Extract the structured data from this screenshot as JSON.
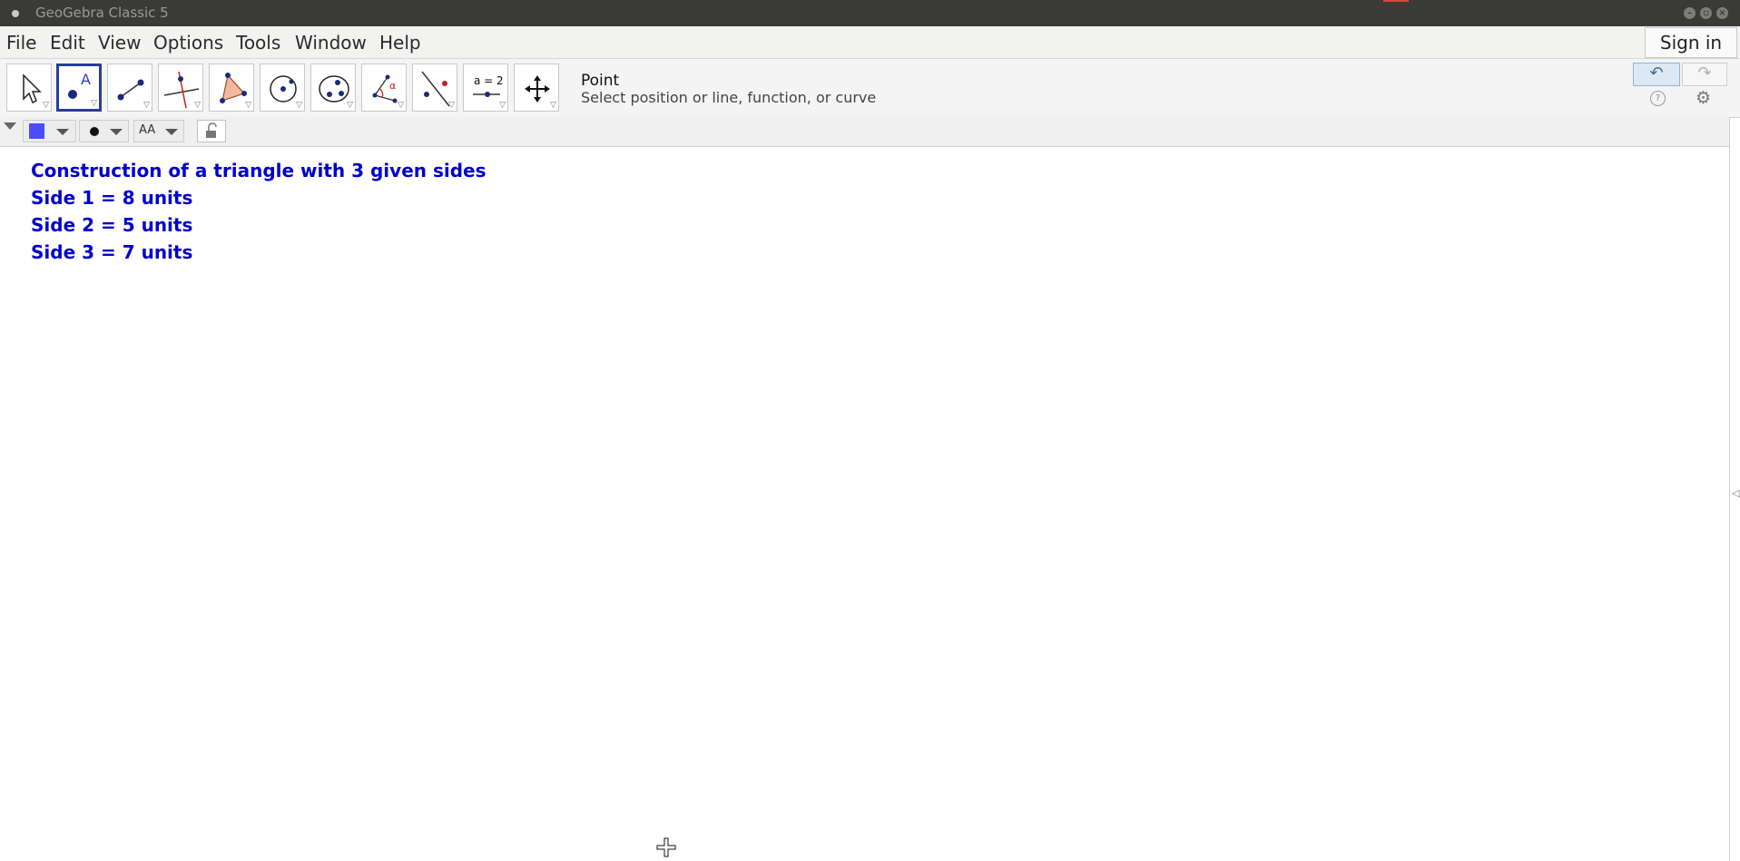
{
  "window": {
    "title": "GeoGebra Classic 5"
  },
  "menu": {
    "items": [
      "File",
      "Edit",
      "View",
      "Options",
      "Tools",
      "Window",
      "Help"
    ],
    "sign_in": "Sign in"
  },
  "toolbar": {
    "tools": [
      "move-tool-icon",
      "point-tool-icon",
      "segment-tool-icon",
      "perpendicular-line-tool-icon",
      "polygon-tool-icon",
      "circle-tool-icon",
      "conic-tool-icon",
      "angle-tool-icon",
      "reflect-tool-icon",
      "slider-tool-icon",
      "move-graphics-view-tool-icon"
    ],
    "selected_tool": "point-tool-icon",
    "slider_tool_text": "a = 2",
    "current_tool_name": "Point",
    "current_tool_help": "Select position or line, function, or curve"
  },
  "stylebar": {
    "color": "#4b4bff",
    "text_size_label": "AA"
  },
  "graphics": {
    "text_color": "#0000cc",
    "lines": [
      "Construction of a triangle with 3 given sides",
      "Side 1 = 8 units",
      "Side 2 = 5 units",
      "Side 3 = 7 units"
    ]
  }
}
